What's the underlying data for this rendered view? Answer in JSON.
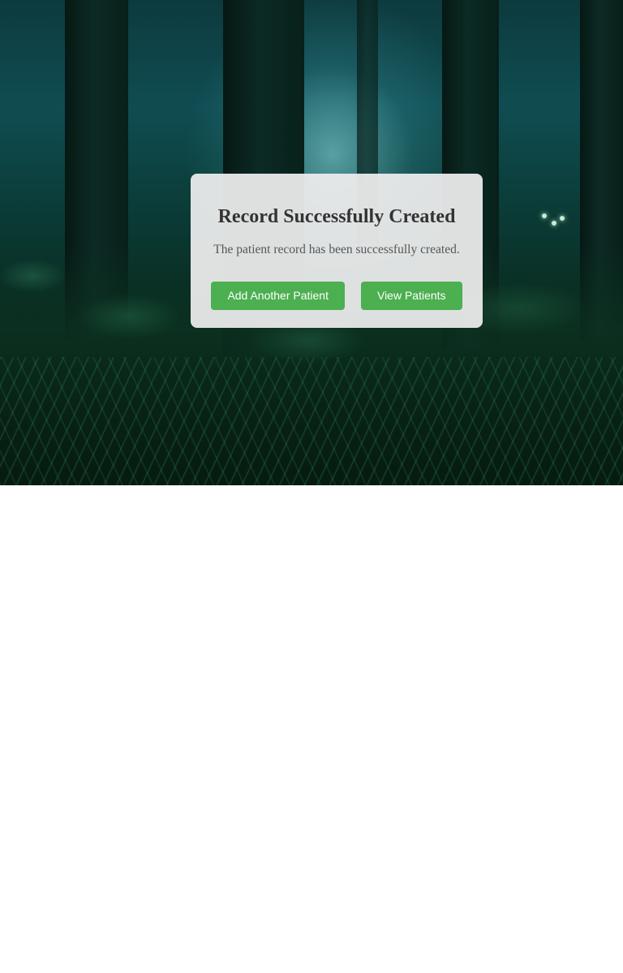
{
  "dialog": {
    "title": "Record Successfully Created",
    "message": "The patient record has been successfully created.",
    "add_button_label": "Add Another Patient",
    "view_button_label": "View Patients"
  },
  "colors": {
    "button_bg": "#4caf50",
    "button_text": "#ffffff",
    "title_text": "#333333",
    "message_text": "#555555",
    "dialog_bg": "#ececec"
  }
}
